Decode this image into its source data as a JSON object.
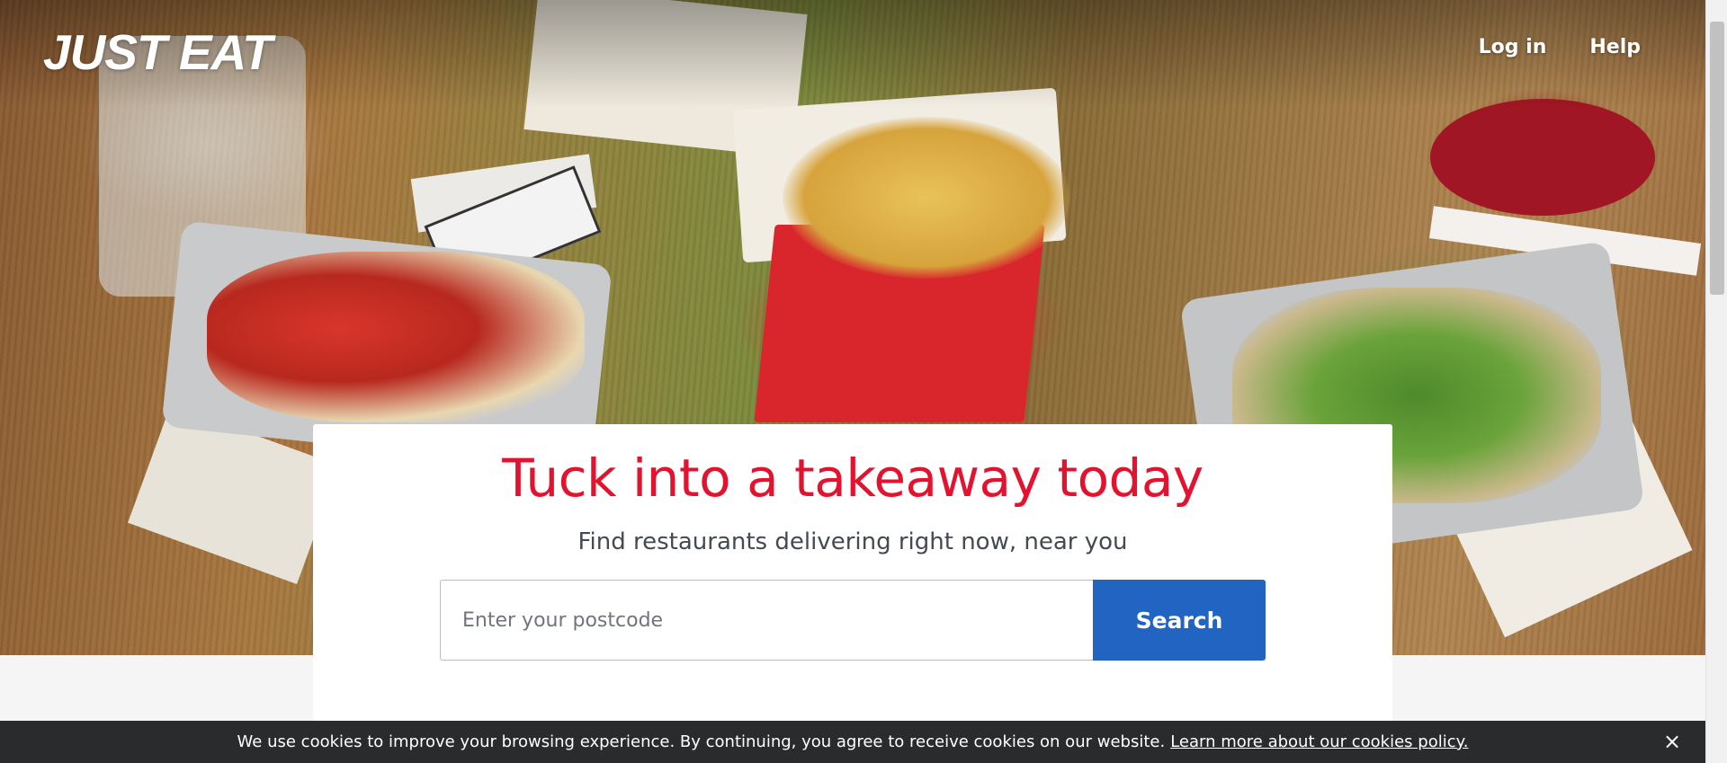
{
  "header": {
    "logo_text": "JUST EAT",
    "nav": {
      "login_label": "Log in",
      "help_label": "Help"
    }
  },
  "hero": {
    "image_icon": "food-photo"
  },
  "search_card": {
    "title": "Tuck into a takeaway today",
    "subtitle": "Find restaurants delivering right now, near you",
    "postcode_placeholder": "Enter your postcode",
    "postcode_value": "",
    "search_label": "Search"
  },
  "cookie_banner": {
    "message": "We use cookies to improve your browsing experience. By continuing, you agree to receive cookies on our website.",
    "link_label": "Learn more about our cookies policy.",
    "close_icon": "×"
  },
  "colors": {
    "brand_red": "#e3132f",
    "search_blue": "#2164c2",
    "banner_bg": "#2a2b2d"
  }
}
